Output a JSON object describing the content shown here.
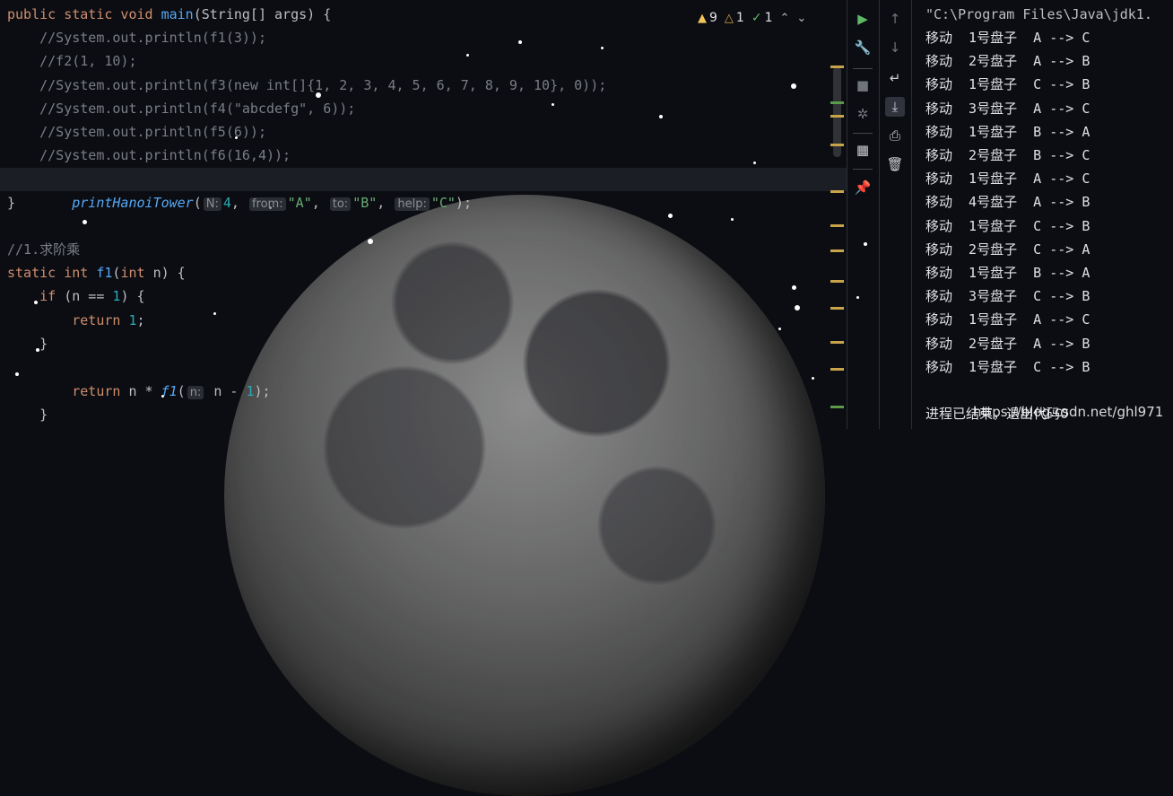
{
  "editor": {
    "lines": [
      {
        "parts": [
          [
            "kw",
            "public static void "
          ],
          [
            "fn",
            "main"
          ],
          [
            "p",
            "(String[] args) {"
          ]
        ]
      },
      {
        "parts": [
          [
            "p",
            "    "
          ],
          [
            "com",
            "//System.out.println(f1(3));"
          ]
        ]
      },
      {
        "parts": [
          [
            "p",
            "    "
          ],
          [
            "com",
            "//f2(1, 10);"
          ]
        ]
      },
      {
        "parts": [
          [
            "p",
            "    "
          ],
          [
            "com",
            "//System.out.println(f3(new int[]{1, 2, 3, 4, 5, 6, 7, 8, 9, 10}, 0));"
          ]
        ]
      },
      {
        "parts": [
          [
            "p",
            "    "
          ],
          [
            "com",
            "//System.out.println(f4(\"abcdefg\", 6));"
          ]
        ]
      },
      {
        "parts": [
          [
            "p",
            "    "
          ],
          [
            "com",
            "//System.out.println(f5(6));"
          ]
        ]
      },
      {
        "parts": [
          [
            "p",
            "    "
          ],
          [
            "com",
            "//System.out.println(f6(16,4));"
          ]
        ]
      },
      {
        "parts": []
      },
      {
        "parts": [
          [
            "p",
            "}"
          ]
        ]
      },
      {
        "parts": []
      },
      {
        "parts": [
          [
            "com",
            "//1.求阶乘"
          ]
        ]
      },
      {
        "parts": [
          [
            "kw",
            "static int "
          ],
          [
            "fn",
            "f1"
          ],
          [
            "p",
            "("
          ],
          [
            "kw",
            "int "
          ],
          [
            "p",
            "n) {"
          ]
        ]
      },
      {
        "parts": [
          [
            "p",
            "    "
          ],
          [
            "kw",
            "if "
          ],
          [
            "p",
            "(n == "
          ],
          [
            "num",
            "1"
          ],
          [
            "p",
            ") {"
          ]
        ]
      },
      {
        "parts": [
          [
            "p",
            "        "
          ],
          [
            "kw",
            "return "
          ],
          [
            "num",
            "1"
          ],
          [
            "p",
            ";"
          ]
        ]
      },
      {
        "parts": [
          [
            "p",
            "    }"
          ]
        ]
      },
      {
        "parts": []
      }
    ],
    "hanoi_call": {
      "name": "printHanoiTower",
      "hint_n": "N:",
      "arg_n": "4",
      "hint_from": "from:",
      "arg_from": "\"A\"",
      "hint_to": "to:",
      "arg_to": "\"B\"",
      "hint_help": "help:",
      "arg_help": "\"C\"",
      "end": ");"
    },
    "return_line": {
      "kw": "return",
      "pre": " n * ",
      "fn": "f1",
      "open": "(",
      "hint": "n:",
      "arg": " n - ",
      "num": "1",
      "end": ");"
    },
    "close_brace": "}"
  },
  "inspections": {
    "warnings": "9",
    "weak_warnings": "1",
    "typos": "1"
  },
  "console": {
    "command": "\"C:\\Program Files\\Java\\jdk1.",
    "moves": [
      "移动  1号盘子  A --> C",
      "移动  2号盘子  A --> B",
      "移动  1号盘子  C --> B",
      "移动  3号盘子  A --> C",
      "移动  1号盘子  B --> A",
      "移动  2号盘子  B --> C",
      "移动  1号盘子  A --> C",
      "移动  4号盘子  A --> B",
      "移动  1号盘子  C --> B",
      "移动  2号盘子  C --> A",
      "移动  1号盘子  B --> A",
      "移动  3号盘子  C --> B",
      "移动  1号盘子  A --> C",
      "移动  2号盘子  A --> B",
      "移动  1号盘子  C --> B"
    ],
    "finish": "进程已结束，退出代码0",
    "watermark": "https://blog.csdn.net/ghl971"
  },
  "icons": {
    "run": "run-icon",
    "settings": "wrench-icon",
    "stop": "stop-icon",
    "debug": "debug-icon",
    "layout": "layout-icon",
    "pin": "pin-icon",
    "up": "arrow-up-icon",
    "down": "arrow-down-icon",
    "wrap": "soft-wrap-icon",
    "scroll": "scroll-to-end-icon",
    "print": "print-icon",
    "trash": "trash-icon"
  },
  "colors": {
    "keyword": "#cf8e6d",
    "function": "#56a8f5",
    "comment": "#7a7e85",
    "number": "#2aacb8",
    "string": "#6aab73",
    "run_green": "#5fb865"
  }
}
